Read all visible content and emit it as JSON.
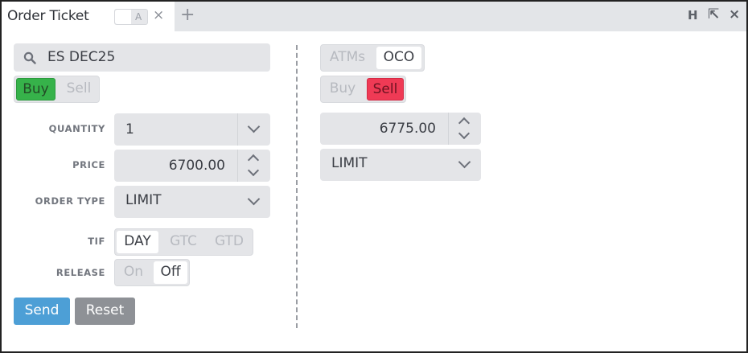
{
  "tab": {
    "title": "Order Ticket",
    "link_letter": "A",
    "close_icon": "×",
    "add_icon": "+"
  },
  "window_controls": {
    "h": "H",
    "popout": "⇱",
    "close": "×"
  },
  "left": {
    "symbol": "ES DEC25",
    "side_options": [
      "Buy",
      "Sell"
    ],
    "side_selected": "Buy",
    "labels": {
      "quantity": "QUANTITY",
      "price": "PRICE",
      "order_type": "ORDER TYPE",
      "tif": "TIF",
      "release": "RELEASE"
    },
    "quantity": "1",
    "price": "6700.00",
    "order_type": "LIMIT",
    "tif_options": [
      "DAY",
      "GTC",
      "GTD"
    ],
    "tif_selected": "DAY",
    "release_options": [
      "On",
      "Off"
    ],
    "release_selected": "Off",
    "send_label": "Send",
    "reset_label": "Reset"
  },
  "right": {
    "bracket_options": [
      "ATMs",
      "OCO"
    ],
    "bracket_selected": "OCO",
    "side_options": [
      "Buy",
      "Sell"
    ],
    "side_selected": "Sell",
    "price": "6775.00",
    "order_type": "LIMIT"
  },
  "colors": {
    "buy": "#36b24a",
    "sell": "#ef3a55",
    "send": "#4d9fd6",
    "reset": "#8e9196"
  }
}
